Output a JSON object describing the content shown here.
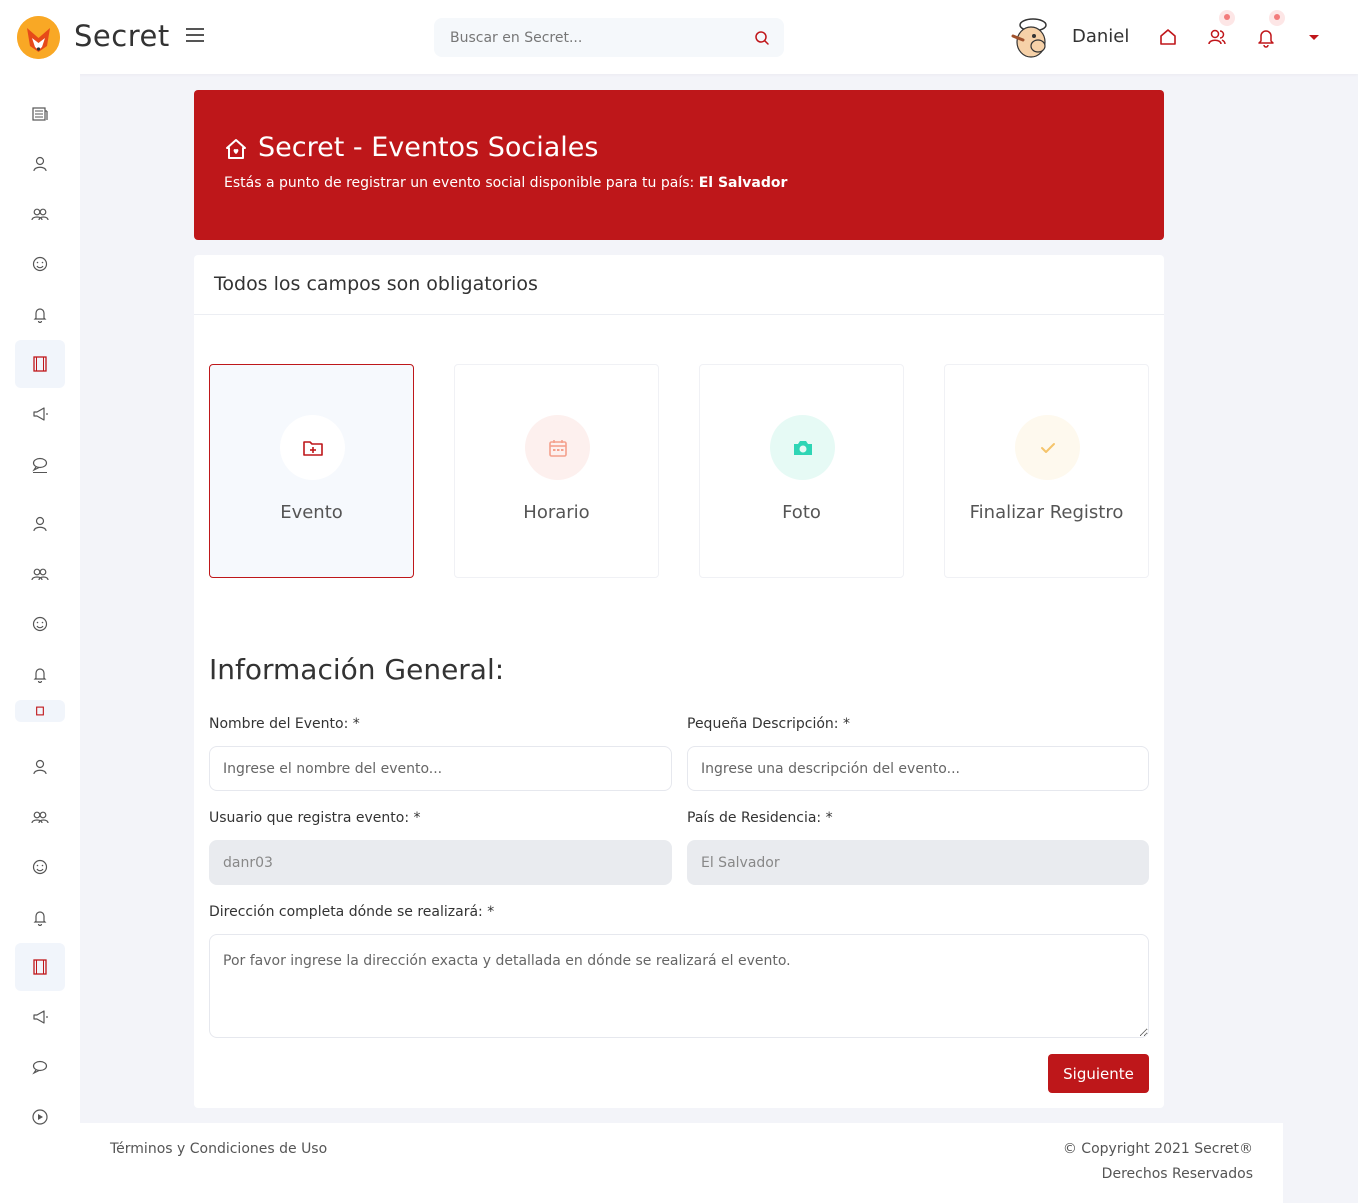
{
  "header": {
    "brand": "Secret",
    "search_placeholder": "Buscar en Secret...",
    "username": "Daniel"
  },
  "banner": {
    "title": "Secret - Eventos Sociales",
    "subtitle": "Estás a punto de registrar un evento social disponible para tu país:",
    "country": "El Salvador"
  },
  "card": {
    "heading": "Todos los campos son obligatorios",
    "steps": [
      {
        "label": "Evento",
        "icon": "folder-plus-icon",
        "color": "#be171a",
        "bg": "#ffffff"
      },
      {
        "label": "Horario",
        "icon": "calendar-icon",
        "color": "#f4a08c",
        "bg": "#fdf0ee"
      },
      {
        "label": "Foto",
        "icon": "camera-icon",
        "color": "#2fd5b5",
        "bg": "#e6faf5"
      },
      {
        "label": "Finalizar Registro",
        "icon": "check-icon",
        "color": "#f5c46b",
        "bg": "#fef9ee"
      }
    ],
    "section_title": "Información General:"
  },
  "form": {
    "event_name_label": "Nombre del Evento: *",
    "event_name_placeholder": "Ingrese el nombre del evento...",
    "description_label": "Pequeña Descripción: *",
    "description_placeholder": "Ingrese una descripción del evento...",
    "user_label": "Usuario que registra evento: *",
    "user_value": "danr03",
    "country_label": "País de Residencia: *",
    "country_value": "El Salvador",
    "address_label": "Dirección completa dónde se realizará: *",
    "address_placeholder": "Por favor ingrese la dirección exacta y detallada en dónde se realizará el evento.",
    "next_button": "Siguiente"
  },
  "footer": {
    "terms": "Términos y Condiciones de Uso",
    "copyright": "© Copyright 2021 Secret®",
    "rights": "Derechos Reservados"
  },
  "colors": {
    "accent": "#be171a",
    "background": "#f3f4f9"
  }
}
